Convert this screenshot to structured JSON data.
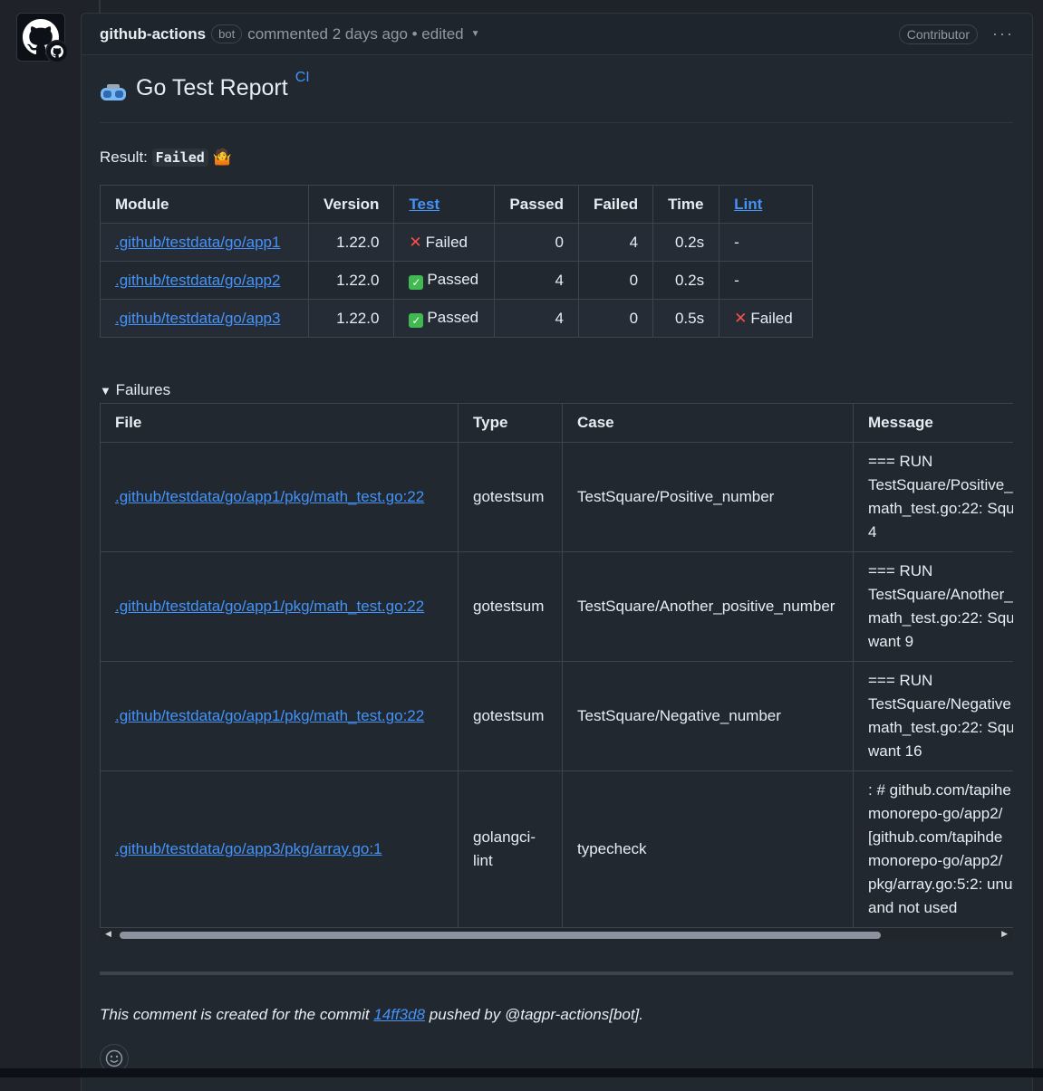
{
  "header": {
    "author": "github-actions",
    "bot_badge": "bot",
    "meta": "commented 2 days ago • edited",
    "contributor": "Contributor",
    "more": "···"
  },
  "report": {
    "title": "Go Test Report",
    "title_sup": "CI",
    "result_label": "Result:",
    "result_value": "Failed",
    "result_emoji": "🤷"
  },
  "modules_table": {
    "headers": [
      "Module",
      "Version",
      "Test",
      "Passed",
      "Failed",
      "Time",
      "Lint"
    ],
    "rows": [
      {
        "module": ".github/testdata/go/app1",
        "version": "1.22.0",
        "test": "Failed",
        "passed": "0",
        "failed": "4",
        "time": "0.2s",
        "lint": "-"
      },
      {
        "module": ".github/testdata/go/app2",
        "version": "1.22.0",
        "test": "Passed",
        "passed": "4",
        "failed": "0",
        "time": "0.2s",
        "lint": "-"
      },
      {
        "module": ".github/testdata/go/app3",
        "version": "1.22.0",
        "test": "Passed",
        "passed": "4",
        "failed": "0",
        "time": "0.5s",
        "lint": "Failed"
      }
    ]
  },
  "failures": {
    "summary": "Failures",
    "headers": [
      "File",
      "Type",
      "Case",
      "Message"
    ],
    "rows": [
      {
        "file": ".github/testdata/go/app1/pkg/math_test.go:22",
        "type": "gotestsum",
        "case": "TestSquare/Positive_number",
        "message": [
          "=== RUN",
          "TestSquare/Positive_n",
          "math_test.go:22: Squ",
          "4"
        ]
      },
      {
        "file": ".github/testdata/go/app1/pkg/math_test.go:22",
        "type": "gotestsum",
        "case": "TestSquare/Another_positive_number",
        "message": [
          "=== RUN",
          "TestSquare/Another_",
          "math_test.go:22: Squ",
          "want 9"
        ]
      },
      {
        "file": ".github/testdata/go/app1/pkg/math_test.go:22",
        "type": "gotestsum",
        "case": "TestSquare/Negative_number",
        "message": [
          "=== RUN",
          "TestSquare/Negative",
          "math_test.go:22: Squ",
          "want 16"
        ]
      },
      {
        "file": ".github/testdata/go/app3/pkg/array.go:1",
        "type": "golangci-lint",
        "case": "typecheck",
        "message": [
          ": # github.com/tapihe",
          "monorepo-go/app2/",
          "[github.com/tapihde",
          "monorepo-go/app2/",
          "pkg/array.go:5:2: unu",
          "and not used"
        ]
      }
    ]
  },
  "footer": {
    "prefix": "This comment is created for the commit",
    "commit": "14ff3d8",
    "suffix": "pushed by @tagpr-actions[bot]."
  }
}
